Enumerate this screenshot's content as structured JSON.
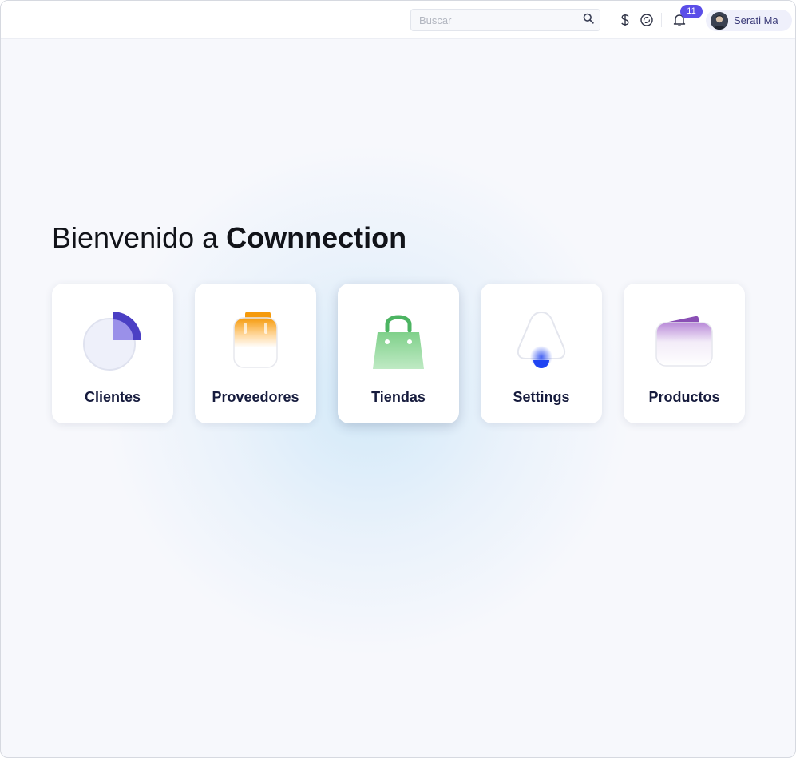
{
  "topbar": {
    "search": {
      "placeholder": "Buscar",
      "value": ""
    },
    "icons": [
      "search-icon",
      "dollar-icon",
      "sync-currency-icon",
      "bell-icon"
    ],
    "notifications_count": "11",
    "user": {
      "name": "Serati Ma"
    }
  },
  "welcome": {
    "prefix": "Bienvenido a ",
    "brand": "Cownnection"
  },
  "cards": [
    {
      "label": "Clientes",
      "icon": "pie-chart-icon",
      "accent": "#4b3fc4"
    },
    {
      "label": "Proveedores",
      "icon": "clipboard-icon",
      "accent": "#f59a0b"
    },
    {
      "label": "Tiendas",
      "icon": "shopping-bag-icon",
      "accent": "#4cb462"
    },
    {
      "label": "Settings",
      "icon": "bell-settings-icon",
      "accent": "#2447f0"
    },
    {
      "label": "Productos",
      "icon": "wallet-icon",
      "accent": "#8a4fb5"
    }
  ],
  "colors": {
    "brand_purple": "#5b4ee8",
    "text_dark": "#161b3d",
    "background": "#f7f8fc"
  }
}
